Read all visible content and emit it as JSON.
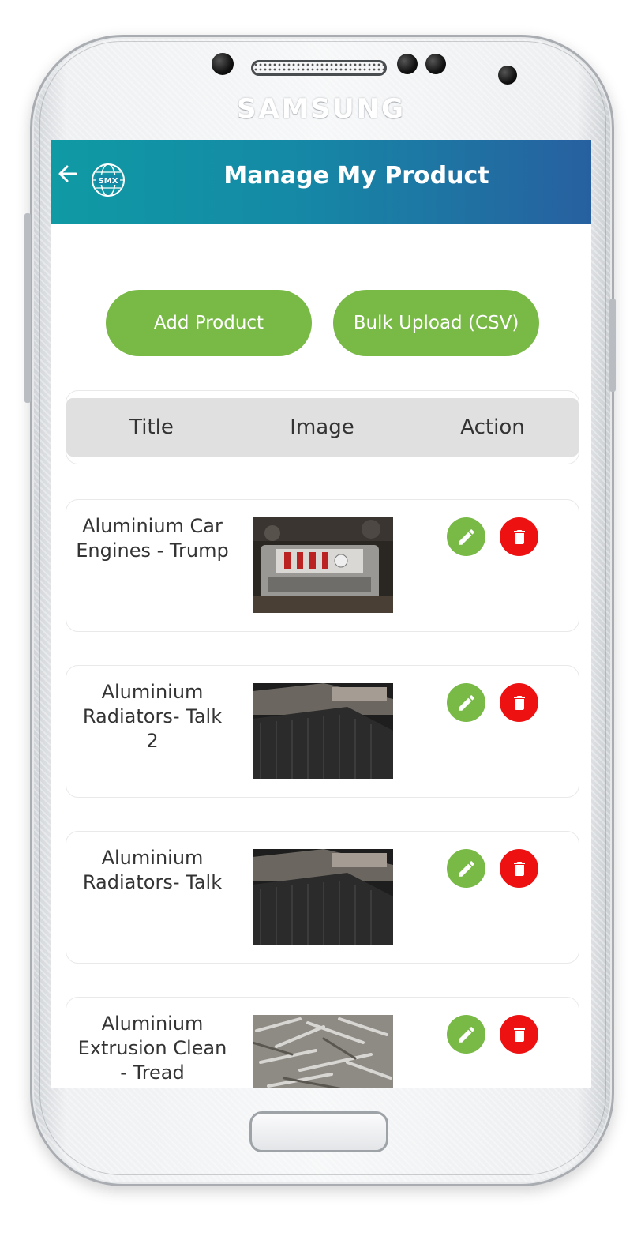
{
  "device": {
    "brand": "SAMSUNG"
  },
  "app_bar": {
    "title": "Manage My Product",
    "back_icon": "arrow-left-icon",
    "logo_text": "SMX"
  },
  "actions": {
    "add_product": "Add Product",
    "bulk_upload": "Bulk Upload (CSV)"
  },
  "table": {
    "headers": {
      "title": "Title",
      "image": "Image",
      "action": "Action"
    },
    "rows": [
      {
        "title": "Aluminium Car Engines - Trump",
        "image": "car-engine-photo"
      },
      {
        "title": "Aluminium Radiators- Talk 2",
        "image": "radiators-photo"
      },
      {
        "title": "Aluminium Radiators- Talk",
        "image": "radiators-photo"
      },
      {
        "title": "Aluminium Extrusion Clean - Tread",
        "image": "extrusion-scrap-photo"
      }
    ],
    "row_actions": {
      "edit_icon": "pencil-icon",
      "delete_icon": "trash-icon"
    }
  },
  "colors": {
    "header_gradient_start": "#0f9aa4",
    "header_gradient_end": "#2760a0",
    "button_green": "#79ba47",
    "delete_red": "#ee1111",
    "table_header_bg": "#e0e0e0"
  }
}
